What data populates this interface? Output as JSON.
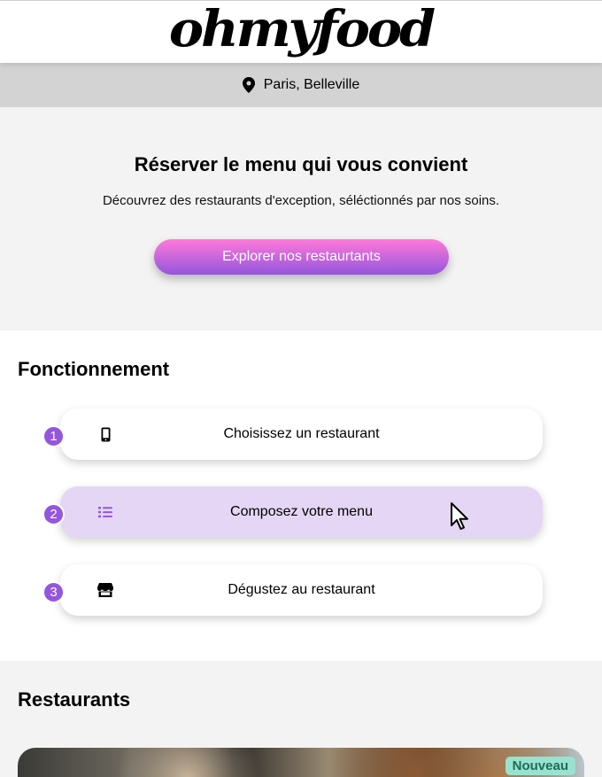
{
  "header": {
    "logo": "ohmyfood"
  },
  "location": {
    "icon": "map-pin-icon",
    "text": "Paris, Belleville"
  },
  "hero": {
    "title": "Réserver le menu qui vous convient",
    "subtitle": "Découvrez des restaurants d'exception, séléctionnés par nos soins.",
    "cta_label": "Explorer nos restaurtants"
  },
  "how": {
    "title": "Fonctionnement",
    "steps": [
      {
        "number": "1",
        "icon": "mobile-phone-icon",
        "label": "Choisissez un restaurant",
        "active": false
      },
      {
        "number": "2",
        "icon": "list-icon",
        "label": "Composez votre menu",
        "active": true
      },
      {
        "number": "3",
        "icon": "store-icon",
        "label": "Dégustez au restaurant",
        "active": false
      }
    ]
  },
  "restaurants": {
    "title": "Restaurants",
    "first_card": {
      "badge": "Nouveau"
    }
  },
  "colors": {
    "accent_purple": "#9356dc",
    "accent_pink": "#ff79da",
    "active_step_bg": "#e5d6f5",
    "badge_bg": "#99e2d0",
    "badge_text": "#1f6b5a"
  }
}
